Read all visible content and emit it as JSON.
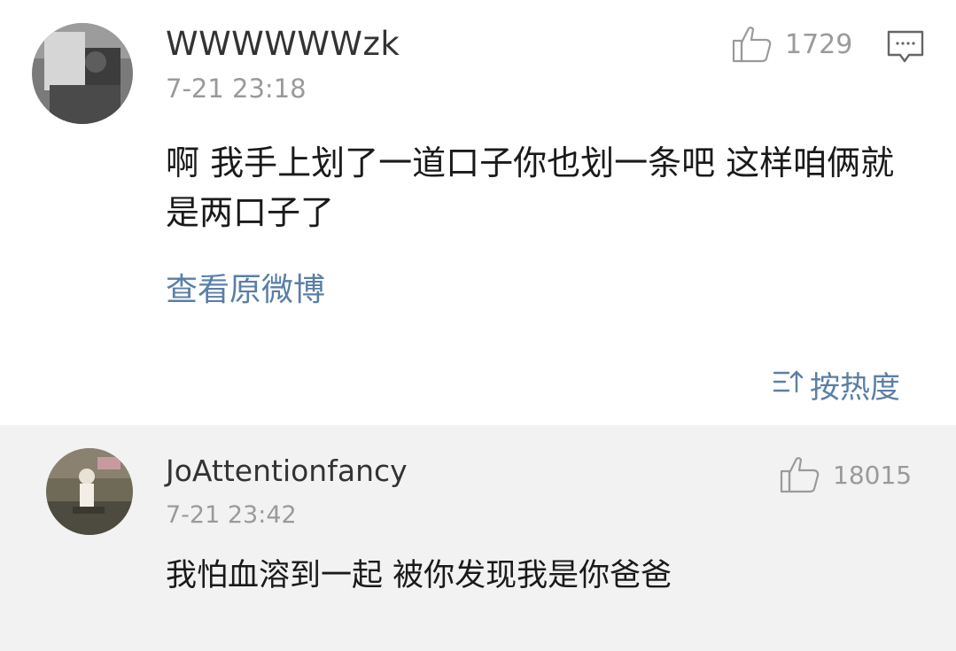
{
  "post": {
    "username": "WWWWWWzk",
    "timestamp": "7-21 23:18",
    "like_count": "1729",
    "content": "啊 我手上划了一道口子你也划一条吧 这样咱俩就是两口子了",
    "view_original": "查看原微博",
    "sort_label": "按热度"
  },
  "reply": {
    "username": "JoAttentionfancy",
    "timestamp": "7-21 23:42",
    "like_count": "18015",
    "content": "我怕血溶到一起 被你发现我是你爸爸"
  },
  "icons": {
    "like": "thumbs-up-icon",
    "comment": "comment-icon",
    "sort": "sort-icon"
  },
  "colors": {
    "link": "#5a7fa6",
    "meta": "#9a9a9a",
    "reply_background": "#f2f2f2"
  }
}
